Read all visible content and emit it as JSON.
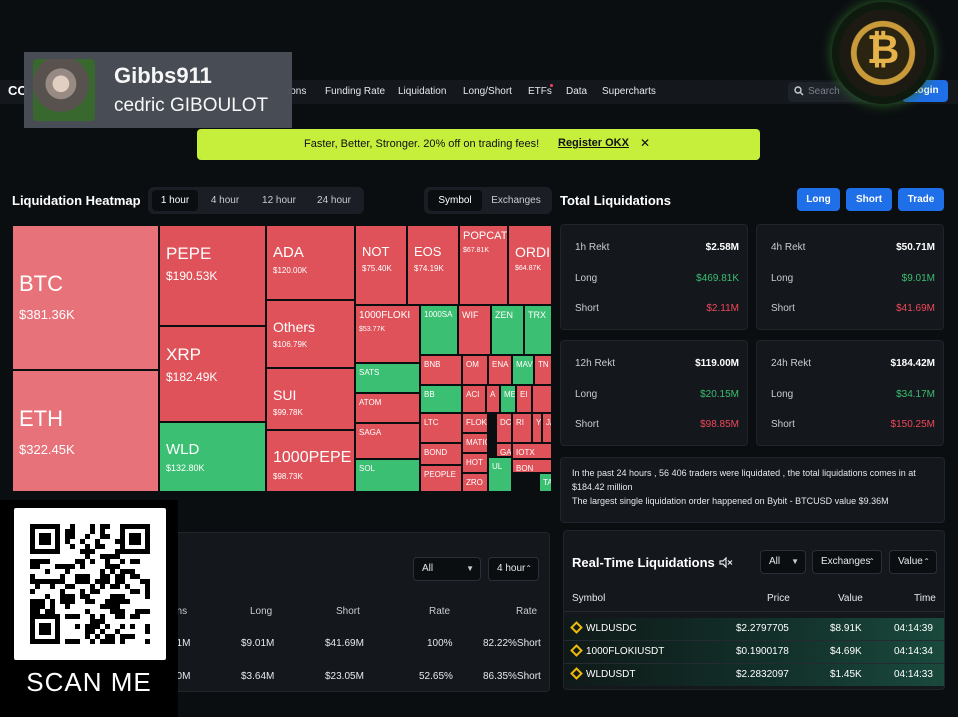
{
  "nav": {
    "logo": "CO",
    "items": [
      "ions",
      "Funding Rate",
      "Liquidation",
      "Long/Short",
      "ETFs",
      "Data",
      "Supercharts"
    ],
    "search_placeholder": "Search",
    "login": "Login"
  },
  "promo": {
    "text": "Faster, Better, Stronger. 20% off on trading fees!",
    "register": "Register OKX",
    "close": "✕"
  },
  "heatmap": {
    "title": "Liquidation Heatmap",
    "time_tabs": [
      "1 hour",
      "4 hour",
      "12 hour",
      "24 hour"
    ],
    "active_time_tab": "1 hour",
    "group_tabs": [
      "Symbol",
      "Exchanges"
    ],
    "active_group_tab": "Symbol",
    "cells": [
      {
        "sym": "BTC",
        "val": "$381.36K",
        "color": "lightred"
      },
      {
        "sym": "ETH",
        "val": "$322.45K",
        "color": "lightred"
      },
      {
        "sym": "PEPE",
        "val": "$190.53K",
        "color": "red"
      },
      {
        "sym": "XRP",
        "val": "$182.49K",
        "color": "red"
      },
      {
        "sym": "WLD",
        "val": "$132.80K",
        "color": "green"
      },
      {
        "sym": "ADA",
        "val": "$120.00K",
        "color": "red"
      },
      {
        "sym": "Others",
        "val": "$106.79K",
        "color": "red"
      },
      {
        "sym": "SUI",
        "val": "$99.78K",
        "color": "red"
      },
      {
        "sym": "1000PEPE",
        "val": "$98.73K",
        "color": "red"
      },
      {
        "sym": "NOT",
        "val": "$75.40K",
        "color": "red"
      },
      {
        "sym": "EOS",
        "val": "$74.19K",
        "color": "red"
      },
      {
        "sym": "POPCAT",
        "val": "$67.81K",
        "color": "red"
      },
      {
        "sym": "ORDI",
        "val": "$64.87K",
        "color": "red"
      },
      {
        "sym": "1000FLOKI",
        "val": "$53.77K",
        "color": "red"
      },
      {
        "sym": "1000SA",
        "val": "",
        "color": "green"
      },
      {
        "sym": "WIF",
        "val": "",
        "color": "red"
      },
      {
        "sym": "ZEN",
        "val": "",
        "color": "green"
      },
      {
        "sym": "TRX",
        "val": "",
        "color": "green"
      },
      {
        "sym": "SATS",
        "val": "",
        "color": "green"
      },
      {
        "sym": "BNB",
        "val": "",
        "color": "red"
      },
      {
        "sym": "OM",
        "val": "",
        "color": "red"
      },
      {
        "sym": "ENA",
        "val": "",
        "color": "red"
      },
      {
        "sym": "MAV",
        "val": "",
        "color": "green"
      },
      {
        "sym": "TN",
        "val": "",
        "color": "red"
      },
      {
        "sym": "ATOM",
        "val": "",
        "color": "red"
      },
      {
        "sym": "BB",
        "val": "",
        "color": "green"
      },
      {
        "sym": "ACI",
        "val": "",
        "color": "red"
      },
      {
        "sym": "A",
        "val": "",
        "color": "red"
      },
      {
        "sym": "ME",
        "val": "",
        "color": "green"
      },
      {
        "sym": "EI",
        "val": "",
        "color": "red"
      },
      {
        "sym": "",
        "val": "",
        "color": "red"
      },
      {
        "sym": "SAGA",
        "val": "",
        "color": "red"
      },
      {
        "sym": "LTC",
        "val": "",
        "color": "red"
      },
      {
        "sym": "FLOKI",
        "val": "",
        "color": "red"
      },
      {
        "sym": "DC",
        "val": "",
        "color": "red"
      },
      {
        "sym": "RI",
        "val": "",
        "color": "red"
      },
      {
        "sym": "YG",
        "val": "",
        "color": "red"
      },
      {
        "sym": "JA",
        "val": "",
        "color": "red"
      },
      {
        "sym": "BOND",
        "val": "",
        "color": "red"
      },
      {
        "sym": "MATIC",
        "val": "",
        "color": "red"
      },
      {
        "sym": "GA",
        "val": "",
        "color": "red"
      },
      {
        "sym": "IOTX",
        "val": "",
        "color": "red"
      },
      {
        "sym": "SOL",
        "val": "",
        "color": "green"
      },
      {
        "sym": "HOT",
        "val": "",
        "color": "red"
      },
      {
        "sym": "BON",
        "val": "",
        "color": "red"
      },
      {
        "sym": "PEOPLE",
        "val": "",
        "color": "red"
      },
      {
        "sym": "ZRO",
        "val": "",
        "color": "red"
      },
      {
        "sym": "UL",
        "val": "",
        "color": "green"
      },
      {
        "sym": "TA",
        "val": "",
        "color": "green"
      }
    ]
  },
  "total": {
    "title": "Total Liquidations",
    "buttons": [
      "Long",
      "Short",
      "Trade"
    ],
    "cards": [
      {
        "label": "1h Rekt",
        "total": "$2.58M",
        "long": "$469.81K",
        "short": "$2.11M"
      },
      {
        "label": "4h Rekt",
        "total": "$50.71M",
        "long": "$9.01M",
        "short": "$41.69M"
      },
      {
        "label": "12h Rekt",
        "total": "$119.00M",
        "long": "$20.15M",
        "short": "$98.85M"
      },
      {
        "label": "24h Rekt",
        "total": "$184.42M",
        "long": "$34.17M",
        "short": "$150.25M"
      }
    ],
    "long_label": "Long",
    "short_label": "Short",
    "summary_line1": "In the past 24 hours , 56 406 traders were liquidated , the total liquidations comes in at $184.42 million",
    "summary_line2": "The largest single liquidation order happened on Bybit - BTCUSD value $9.36M"
  },
  "realtime": {
    "title": "Real-Time Liquidations",
    "filters": [
      "All",
      "Exchanges",
      "Value"
    ],
    "columns": [
      "Symbol",
      "Price",
      "Value",
      "Time"
    ],
    "rows": [
      {
        "symbol": "WLDUSDC",
        "price": "$2.2797705",
        "value": "$8.91K",
        "time": "04:14:39"
      },
      {
        "symbol": "1000FLOKIUSDT",
        "price": "$0.1900178",
        "value": "$4.69K",
        "time": "04:14:34"
      },
      {
        "symbol": "WLDUSDT",
        "price": "$2.2832097",
        "value": "$1.45K",
        "time": "04:14:33"
      }
    ]
  },
  "exchange_table": {
    "filters": [
      "All",
      "4 hour"
    ],
    "columns": [
      "ons",
      "Long",
      "Short",
      "Rate",
      "Rate"
    ],
    "rows": [
      {
        "c0": "71M",
        "long": "$9.01M",
        "short": "$41.69M",
        "rate": "100%",
        "rate2": "82.22%Short"
      },
      {
        "c0": "70M",
        "long": "$3.64M",
        "short": "$23.05M",
        "rate": "52.65%",
        "rate2": "86.35%Short"
      }
    ]
  },
  "overlay": {
    "profile_name": "Gibbs911",
    "profile_sub": "cedric GIBOULOT",
    "coin_symbol": "₿",
    "scan_label": "SCAN ME"
  },
  "colors": {
    "accent": "#1e6fe8",
    "promo": "#c5ef3a",
    "positive": "#3bbf72",
    "negative": "#f0475a",
    "heat_red": "#e0525a"
  }
}
